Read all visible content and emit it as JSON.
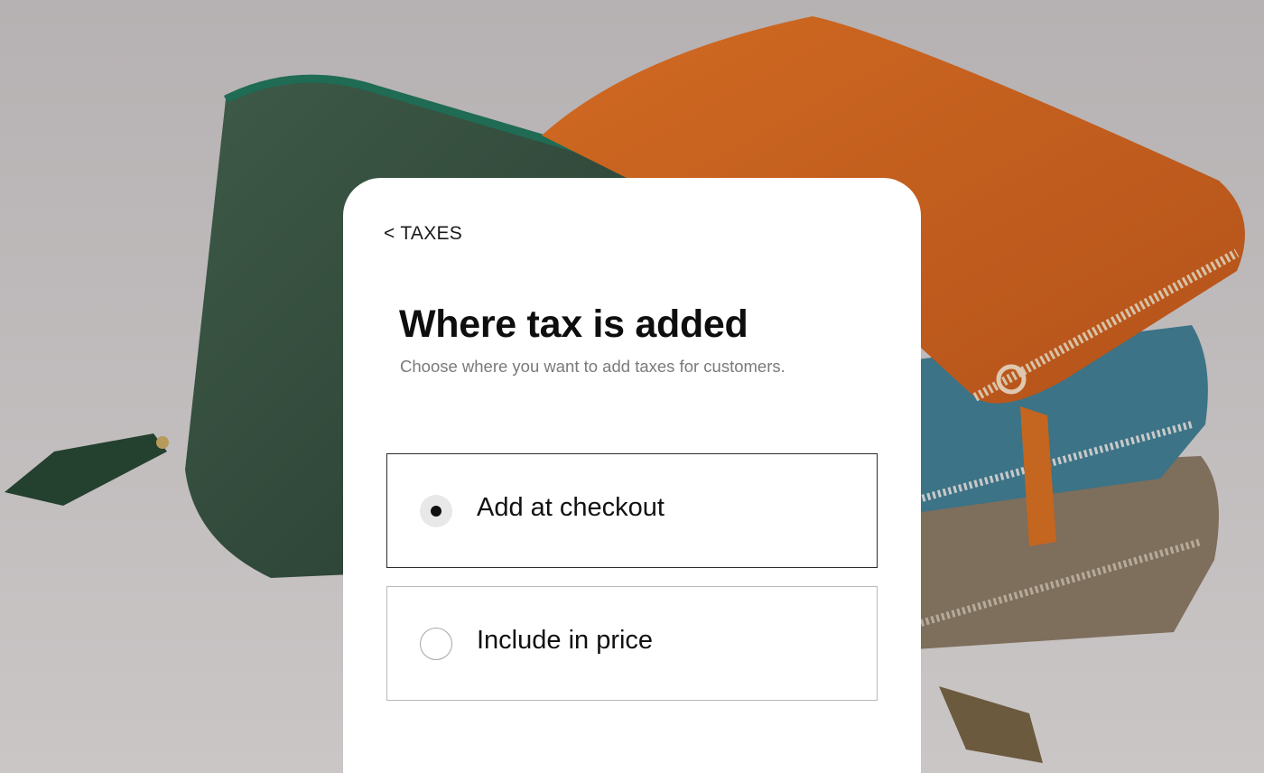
{
  "nav": {
    "back_label": "< TAXES"
  },
  "header": {
    "title": "Where tax is added",
    "subtitle": "Choose where you want to add taxes for customers."
  },
  "options": [
    {
      "label": "Add at checkout",
      "selected": true
    },
    {
      "label": "Include in price",
      "selected": false
    }
  ],
  "colors": {
    "background": "#bdb8b8",
    "wallet_green": "#2f4a3a",
    "wallet_orange": "#c8621d",
    "wallet_teal": "#3e7385",
    "wallet_taupe": "#7a6a58"
  }
}
